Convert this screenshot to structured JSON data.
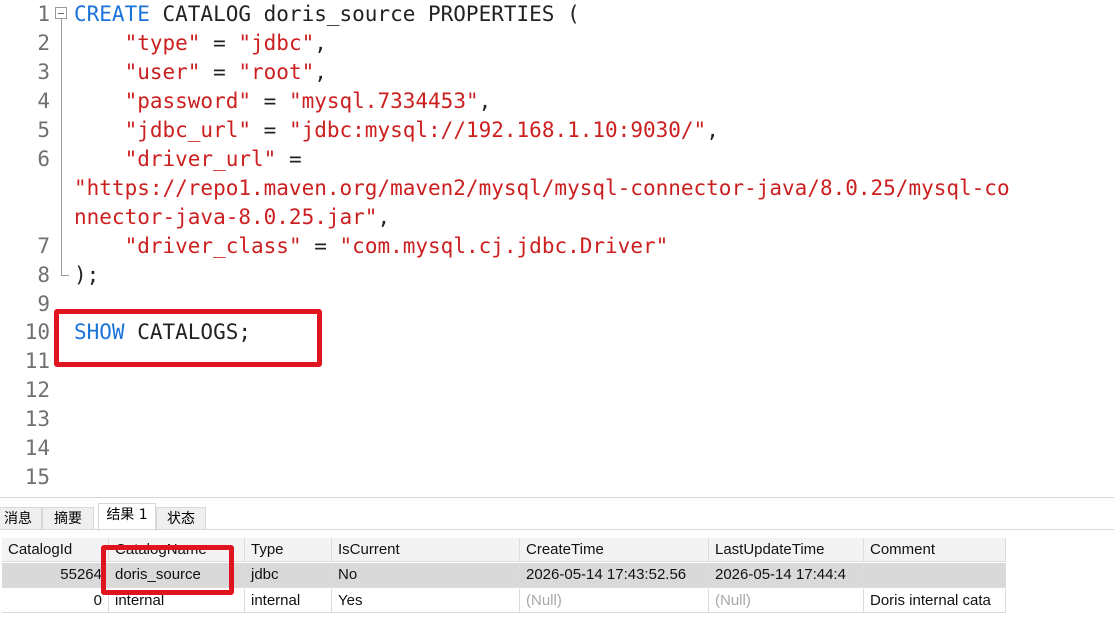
{
  "editor": {
    "line_numbers": [
      "1",
      "2",
      "3",
      "4",
      "5",
      "6",
      "",
      "",
      "7",
      "8",
      "9",
      "10",
      "11",
      "12",
      "13",
      "15"
    ],
    "lines": [
      [
        {
          "t": "CREATE",
          "c": "kw"
        },
        {
          "t": " CATALOG doris_source PROPERTIES (",
          "c": "plain"
        }
      ],
      [
        {
          "t": "    ",
          "c": "plain"
        },
        {
          "t": "\"type\"",
          "c": "str"
        },
        {
          "t": " = ",
          "c": "plain"
        },
        {
          "t": "\"jdbc\"",
          "c": "str"
        },
        {
          "t": ",",
          "c": "plain"
        }
      ],
      [
        {
          "t": "    ",
          "c": "plain"
        },
        {
          "t": "\"user\"",
          "c": "str"
        },
        {
          "t": " = ",
          "c": "plain"
        },
        {
          "t": "\"root\"",
          "c": "str"
        },
        {
          "t": ",",
          "c": "plain"
        }
      ],
      [
        {
          "t": "    ",
          "c": "plain"
        },
        {
          "t": "\"password\"",
          "c": "str"
        },
        {
          "t": " = ",
          "c": "plain"
        },
        {
          "t": "\"mysql.7334453\"",
          "c": "str"
        },
        {
          "t": ",",
          "c": "plain"
        }
      ],
      [
        {
          "t": "    ",
          "c": "plain"
        },
        {
          "t": "\"jdbc_url\"",
          "c": "str"
        },
        {
          "t": " = ",
          "c": "plain"
        },
        {
          "t": "\"jdbc:mysql://192.168.1.10:9030/\"",
          "c": "str"
        },
        {
          "t": ",",
          "c": "plain"
        }
      ],
      [
        {
          "t": "    ",
          "c": "plain"
        },
        {
          "t": "\"driver_url\"",
          "c": "str"
        },
        {
          "t": " =",
          "c": "plain"
        }
      ],
      [
        {
          "t": "\"https://repo1.maven.org/maven2/mysql/mysql-connector-java/8.0.25/mysql-co",
          "c": "str"
        }
      ],
      [
        {
          "t": "nnector-java-8.0.25.jar\"",
          "c": "str"
        },
        {
          "t": ",",
          "c": "plain"
        }
      ],
      [
        {
          "t": "    ",
          "c": "plain"
        },
        {
          "t": "\"driver_class\"",
          "c": "str"
        },
        {
          "t": " = ",
          "c": "plain"
        },
        {
          "t": "\"com.mysql.cj.jdbc.Driver\"",
          "c": "str"
        }
      ],
      [
        {
          "t": ");",
          "c": "plain"
        }
      ],
      [],
      [
        {
          "t": "SHOW",
          "c": "kw"
        },
        {
          "t": " CATALOGS;",
          "c": "plain"
        }
      ],
      [],
      [],
      [],
      []
    ],
    "extra_line_numbers": [
      "14"
    ]
  },
  "results": {
    "tabs": [
      "消息",
      "摘要",
      "结果 1",
      "状态"
    ],
    "active_tab": 2,
    "columns": [
      "CatalogId",
      "CatalogName",
      "Type",
      "IsCurrent",
      "CreateTime",
      "LastUpdateTime",
      "Comment"
    ],
    "rows": [
      [
        "55264",
        "doris_source",
        "jdbc",
        "No",
        "2026-05-14 17:43:52.56",
        "2026-05-14 17:44:4",
        ""
      ],
      [
        "0",
        "internal",
        "internal",
        "Yes",
        "(Null)",
        "(Null)",
        "Doris internal cata"
      ]
    ]
  },
  "colors": {
    "keyword": "#1a73d9",
    "string": "#cc1f1f",
    "highlight": "#e0141e"
  }
}
